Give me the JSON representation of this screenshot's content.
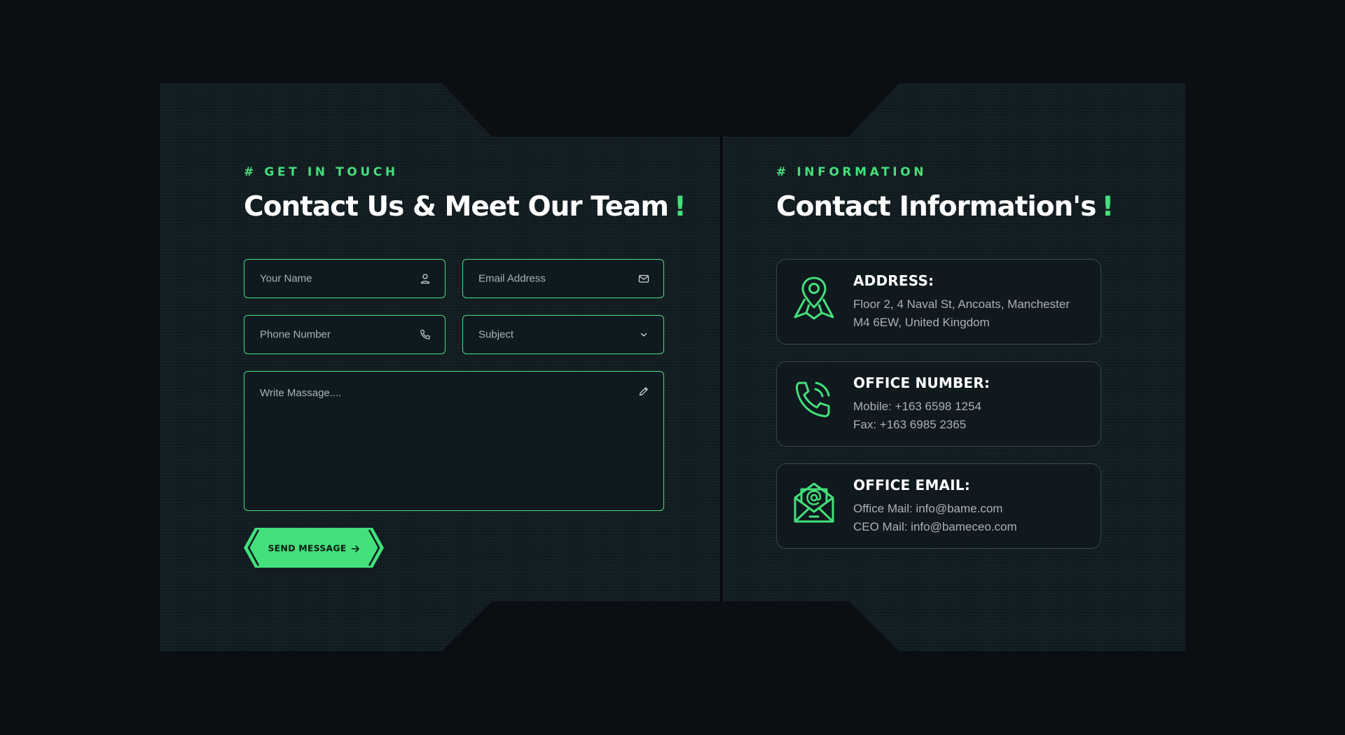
{
  "contact_form": {
    "eyebrow": "# GET IN TOUCH",
    "heading": "Contact Us & Meet Our Team",
    "heading_accent": "!",
    "name_placeholder": "Your Name",
    "email_placeholder": "Email Address",
    "phone_placeholder": "Phone Number",
    "subject_value": "Subject",
    "message_placeholder": "Write Massage....",
    "send_label": "SEND MESSAGE"
  },
  "information": {
    "eyebrow": "# INFORMATION",
    "heading": "Contact Information's",
    "heading_accent": "!",
    "cards": [
      {
        "icon": "map-pin-icon",
        "title": "ADDRESS:",
        "lines": [
          "Floor 2, 4 Naval St, Ancoats, Manchester",
          "M4 6EW, United Kingdom"
        ]
      },
      {
        "icon": "phone-ringing-icon",
        "title": "OFFICE NUMBER:",
        "lines": [
          "Mobile: +163 6598 1254",
          "Fax: +163 6985 2365"
        ]
      },
      {
        "icon": "email-envelope-icon",
        "title": "OFFICE EMAIL:",
        "lines": [
          "Office Mail: info@bame.com",
          "CEO Mail: info@bameceo.com"
        ]
      }
    ]
  },
  "colors": {
    "accent": "#43e07b",
    "background": "#0b0f14",
    "panel": "#121d22",
    "text": "#ffffff",
    "muted_text": "#a9b2b8"
  }
}
